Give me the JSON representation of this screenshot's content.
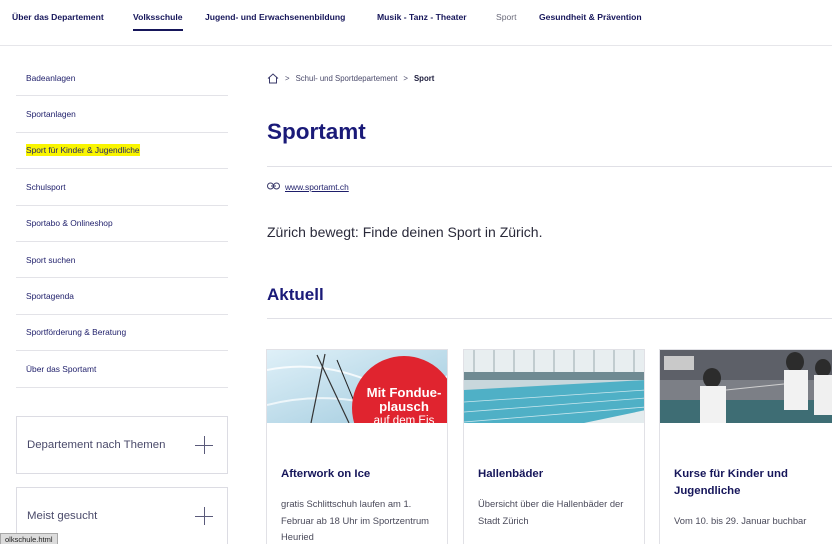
{
  "topnav": {
    "items": [
      "Über das Departement",
      "Volksschule",
      "Jugend- und Erwachsenenbildung",
      "Musik - Tanz - Theater",
      "Sport",
      "Gesundheit & Prävention"
    ]
  },
  "sidebar": {
    "items": [
      "Badeanlagen",
      "Sportanlagen",
      "Sport für Kinder & Jugendliche",
      "Schulsport",
      "Sportabo & Onlineshop",
      "Sport suchen",
      "Sportagenda",
      "Sportförderung & Beratung",
      "Über das Sportamt"
    ],
    "boxes": [
      "Departement nach Themen",
      "Meist gesucht"
    ]
  },
  "breadcrumb": {
    "parent": "Schul- und Sportdepartement",
    "separator": ">",
    "current": "Sport"
  },
  "page": {
    "title": "Sportamt",
    "weblink": "www.sportamt.ch",
    "lead": "Zürich bewegt: Finde deinen Sport in Zürich.",
    "section_title": "Aktuell"
  },
  "cards": [
    {
      "title": "Afterwork on Ice",
      "text": "gratis Schlittschuh laufen am 1. Februar ab 18 Uhr im Sportzentrum Heuried",
      "badge": [
        "Mit Fondue-",
        "plausch",
        "auf dem Eis"
      ]
    },
    {
      "title": "Hallenbäder",
      "text": "Übersicht über die Hallenbäder der Stadt Zürich"
    },
    {
      "title": "Kurse für Kinder und Jugendliche",
      "text": "Vom 10. bis 29. Januar buchbar"
    }
  ],
  "status": {
    "url": "olkschule.html"
  },
  "colors": {
    "brand": "#1a1a78",
    "highlight": "#f9f500",
    "badge_red": "#e0242f"
  },
  "icons": [
    "home-icon",
    "link-icon",
    "plus-icon"
  ]
}
